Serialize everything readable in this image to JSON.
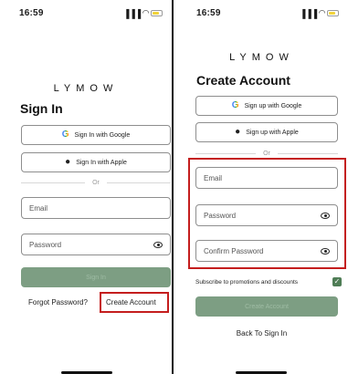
{
  "signin": {
    "status": {
      "time": "16:59",
      "signal": "‥…",
      "wifi": "◔"
    },
    "logo": "LYMOW",
    "title": "Sign In",
    "google_label": "Sign In with Google",
    "apple_label": "Sign In with Apple",
    "divider": "Or",
    "email_placeholder": "Email",
    "password_placeholder": "Password",
    "submit_label": "Sign In",
    "forgot_label": "Forgot Password?",
    "create_label": "Create Account"
  },
  "signup": {
    "status": {
      "time": "16:59",
      "signal": "‥…",
      "wifi": "◔"
    },
    "logo": "LYMOW",
    "title": "Create Account",
    "google_label": "Sign up with Google",
    "apple_label": "Sign up with Apple",
    "divider": "Or",
    "email_placeholder": "Email",
    "password_placeholder": "Password",
    "confirm_placeholder": "Confirm Password",
    "subscribe_label": "Subscribe to promotions and discounts",
    "subscribe_checked": true,
    "submit_label": "Create Account",
    "back_label": "Back To Sign In"
  },
  "colors": {
    "primary": "#7d9e83",
    "highlight": "#c41d1d",
    "check": "#4f7d56"
  }
}
